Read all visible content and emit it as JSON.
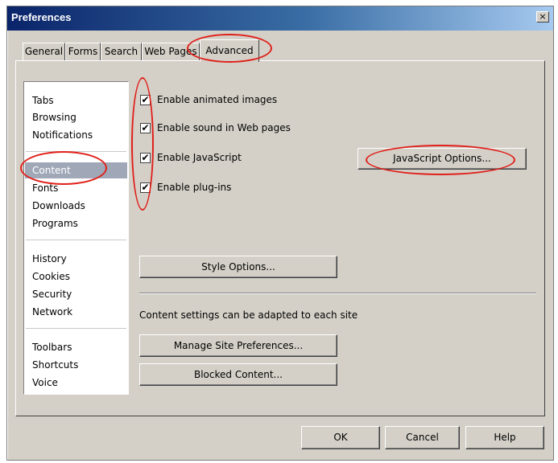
{
  "window": {
    "title": "Preferences",
    "close_label": "×"
  },
  "tabs": [
    {
      "label": "General"
    },
    {
      "label": "Forms"
    },
    {
      "label": "Search"
    },
    {
      "label": "Web Pages"
    },
    {
      "label": "Advanced",
      "active": true
    }
  ],
  "sidebar": {
    "groups": [
      [
        "Tabs",
        "Browsing",
        "Notifications"
      ],
      [
        "Content",
        "Fonts",
        "Downloads",
        "Programs"
      ],
      [
        "History",
        "Cookies",
        "Security",
        "Network"
      ],
      [
        "Toolbars",
        "Shortcuts",
        "Voice"
      ]
    ],
    "selected": "Content"
  },
  "content": {
    "checkboxes": [
      {
        "label": "Enable animated images",
        "checked": true
      },
      {
        "label": "Enable sound in Web pages",
        "checked": true
      },
      {
        "label": "Enable JavaScript",
        "checked": true
      },
      {
        "label": "Enable plug-ins",
        "checked": true
      }
    ],
    "check_mark": "✔",
    "javascript_options_label": "JavaScript Options...",
    "style_options_label": "Style Options...",
    "site_settings_text": "Content settings can be adapted to each site",
    "manage_site_prefs_label": "Manage Site Preferences...",
    "blocked_content_label": "Blocked Content..."
  },
  "footer": {
    "ok_label": "OK",
    "cancel_label": "Cancel",
    "help_label": "Help"
  },
  "colors": {
    "annotation": "#e0201a",
    "selection": "#a0a8b8",
    "titlebar_start": "#0a246a"
  }
}
